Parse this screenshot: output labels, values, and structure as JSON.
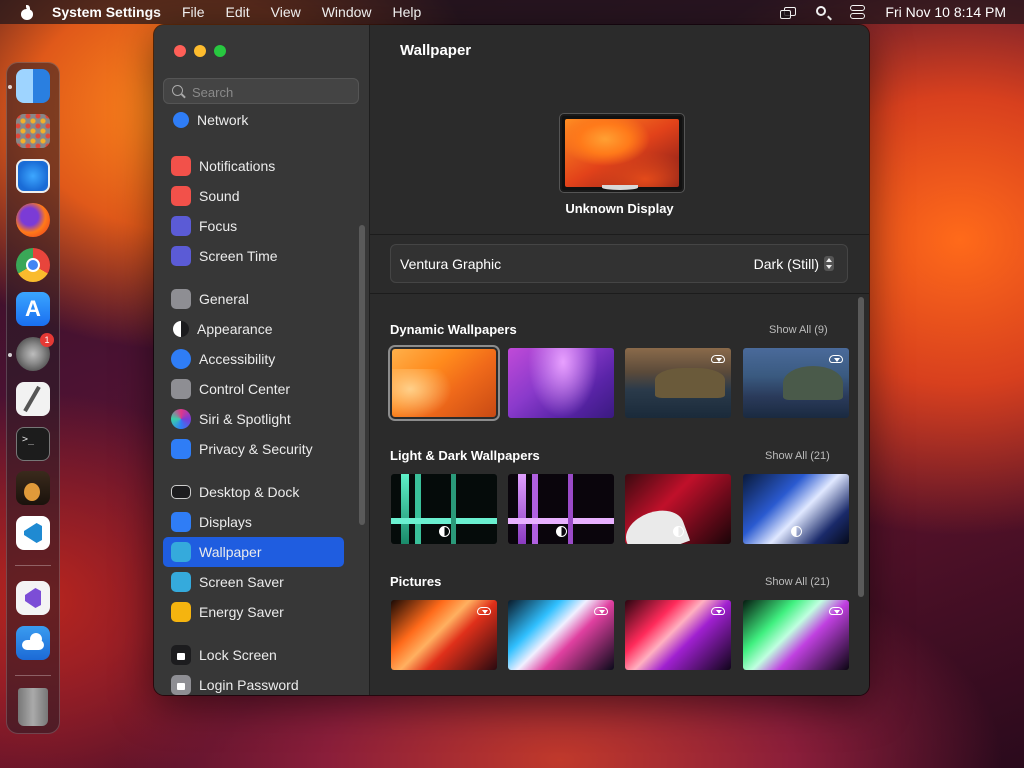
{
  "menubar": {
    "app": "System Settings",
    "items": [
      "File",
      "Edit",
      "View",
      "Window",
      "Help"
    ],
    "clock": "Fri Nov 10  8:14 PM"
  },
  "dock": {
    "apps": [
      "finder",
      "launchpad",
      "safari",
      "firefox",
      "chrome",
      "app-store",
      "system-settings",
      "textedit",
      "terminal",
      "garageband",
      "vscode",
      "visual-studio",
      "weather",
      "trash"
    ],
    "badge": "1"
  },
  "sidebar": {
    "search_placeholder": "Search",
    "items": [
      {
        "label": "Network",
        "icon": "globe-icon",
        "color": "#2f7df6"
      },
      {
        "label": "Notifications",
        "icon": "bell-icon",
        "color": "#f2514a"
      },
      {
        "label": "Sound",
        "icon": "speaker-icon",
        "color": "#f2514a"
      },
      {
        "label": "Focus",
        "icon": "moon-icon",
        "color": "#5b5bd6"
      },
      {
        "label": "Screen Time",
        "icon": "hourglass-icon",
        "color": "#5b5bd6"
      },
      {
        "label": "General",
        "icon": "gear-icon",
        "color": "#8e8e93"
      },
      {
        "label": "Appearance",
        "icon": "appearance-icon",
        "color": "#1c1c1e"
      },
      {
        "label": "Accessibility",
        "icon": "accessibility-icon",
        "color": "#2f7df6"
      },
      {
        "label": "Control Center",
        "icon": "control-center-icon",
        "color": "#8e8e93"
      },
      {
        "label": "Siri & Spotlight",
        "icon": "siri-icon",
        "color": "#b04ac9"
      },
      {
        "label": "Privacy & Security",
        "icon": "hand-icon",
        "color": "#2f7df6"
      },
      {
        "label": "Desktop & Dock",
        "icon": "dock-icon",
        "color": "#1c1c1e"
      },
      {
        "label": "Displays",
        "icon": "sun-icon",
        "color": "#2f7df6"
      },
      {
        "label": "Wallpaper",
        "icon": "flower-icon",
        "color": "#35aadc"
      },
      {
        "label": "Screen Saver",
        "icon": "screen-saver-icon",
        "color": "#35aadc"
      },
      {
        "label": "Energy Saver",
        "icon": "bulb-icon",
        "color": "#f5b40f"
      },
      {
        "label": "Lock Screen",
        "icon": "lock-icon",
        "color": "#1c1c1e"
      },
      {
        "label": "Login Password",
        "icon": "lock-icon",
        "color": "#8e8e93"
      }
    ],
    "selected": "Wallpaper"
  },
  "main": {
    "title": "Wallpaper",
    "display_name": "Unknown Display",
    "current": {
      "name": "Ventura Graphic",
      "mode": "Dark (Still)"
    },
    "sections": [
      {
        "title": "Dynamic Wallpapers",
        "show_all": "Show All (9)"
      },
      {
        "title": "Light & Dark Wallpapers",
        "show_all": "Show All (21)"
      },
      {
        "title": "Pictures",
        "show_all": "Show All (21)"
      }
    ]
  },
  "colors": {
    "accent": "#1f5de0"
  }
}
